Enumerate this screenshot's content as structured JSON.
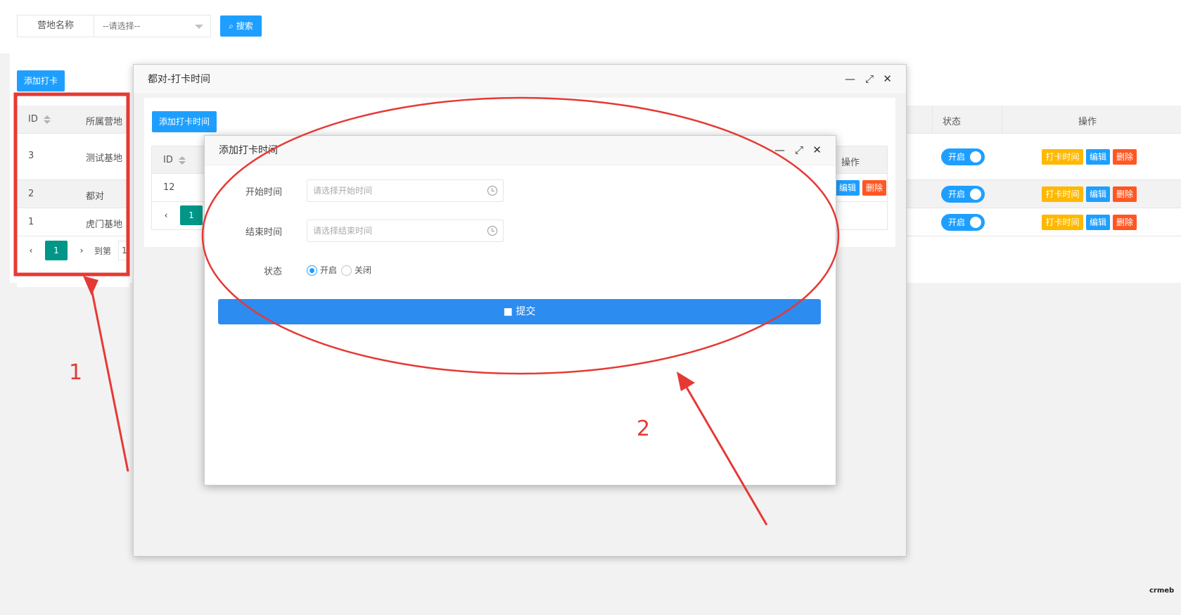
{
  "search": {
    "field_label": "营地名称",
    "select_value": "--请选择--",
    "button_label": "搜索"
  },
  "toolbar": {
    "add_label": "添加打卡"
  },
  "main_table": {
    "headers": {
      "id": "ID",
      "camp": "所属营地",
      "status": "状态",
      "ops": "操作"
    },
    "rows": [
      {
        "id": "3",
        "camp": "测试基地",
        "status": "开启"
      },
      {
        "id": "2",
        "camp": "都对",
        "status": "开启"
      },
      {
        "id": "1",
        "camp": "虎门基地",
        "status": "开启"
      }
    ],
    "op_labels": {
      "time": "打卡时间",
      "edit": "编辑",
      "delete": "删除"
    },
    "pagination": {
      "current": "1",
      "goto_label": "到第",
      "goto_value": "1"
    }
  },
  "modal_outer": {
    "title": "都对-打卡时间",
    "add_label": "添加打卡时间",
    "table": {
      "headers": {
        "id": "ID",
        "ops": "操作"
      },
      "rows": [
        {
          "id": "12"
        }
      ],
      "op_labels": {
        "edit": "编辑",
        "delete": "删除"
      }
    },
    "pagination": {
      "current": "1"
    }
  },
  "modal_inner": {
    "title": "添加打卡时间",
    "start_label": "开始时间",
    "start_placeholder": "请选择开始时间",
    "end_label": "结束时间",
    "end_placeholder": "请选择结束时间",
    "status_label": "状态",
    "status_on": "开启",
    "status_off": "关闭",
    "submit_label": "提交"
  },
  "annotations": {
    "label_1": "1",
    "label_2": "2",
    "accent": "#e53935"
  },
  "watermark": "crmeb",
  "colors": {
    "primary": "#1e9fff",
    "teal": "#009688",
    "orange": "#ffb800",
    "red": "#ff5722",
    "submit": "#2d8cf0"
  }
}
